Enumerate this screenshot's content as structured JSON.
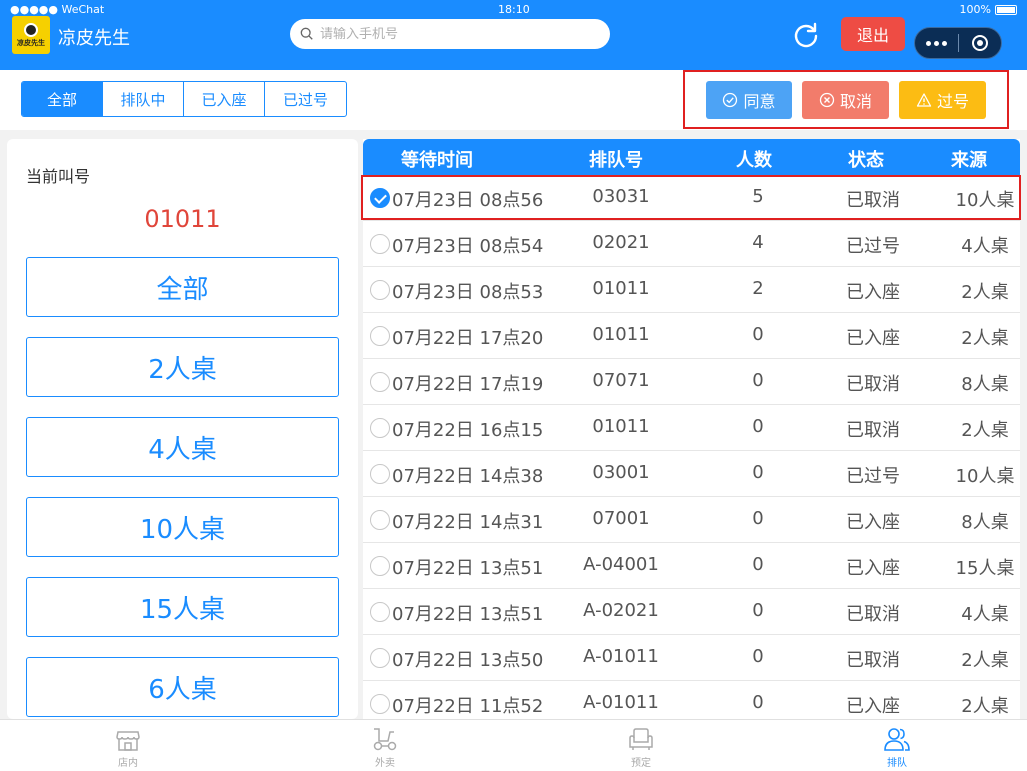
{
  "status_bar": {
    "carrier": "●●●●● WeChat",
    "time": "18:10",
    "battery": "100%"
  },
  "header": {
    "logo_text": "凉皮先生",
    "title": "凉皮先生",
    "search_placeholder": "请输入手机号",
    "logout": "退出"
  },
  "filters": {
    "tabs": [
      "全部",
      "排队中",
      "已入座",
      "已过号"
    ],
    "active": 0
  },
  "actions": {
    "agree": "同意",
    "cancel": "取消",
    "pass": "过号"
  },
  "left_panel": {
    "current_label": "当前叫号",
    "current_number": "01011",
    "categories": [
      "全部",
      "2人桌",
      "4人桌",
      "10人桌",
      "15人桌",
      "6人桌"
    ]
  },
  "table": {
    "headers": [
      "等待时间",
      "排队号",
      "人数",
      "状态",
      "来源"
    ],
    "rows": [
      {
        "time": "07月23日 08点56",
        "number": "03031",
        "people": "5",
        "status": "已取消",
        "source": "10人桌",
        "selected": true
      },
      {
        "time": "07月23日 08点54",
        "number": "02021",
        "people": "4",
        "status": "已过号",
        "source": "4人桌",
        "selected": false
      },
      {
        "time": "07月23日 08点53",
        "number": "01011",
        "people": "2",
        "status": "已入座",
        "source": "2人桌",
        "selected": false
      },
      {
        "time": "07月22日 17点20",
        "number": "01011",
        "people": "0",
        "status": "已入座",
        "source": "2人桌",
        "selected": false
      },
      {
        "time": "07月22日 17点19",
        "number": "07071",
        "people": "0",
        "status": "已取消",
        "source": "8人桌",
        "selected": false
      },
      {
        "time": "07月22日 16点15",
        "number": "01011",
        "people": "0",
        "status": "已取消",
        "source": "2人桌",
        "selected": false
      },
      {
        "time": "07月22日 14点38",
        "number": "03001",
        "people": "0",
        "status": "已过号",
        "source": "10人桌",
        "selected": false
      },
      {
        "time": "07月22日 14点31",
        "number": "07001",
        "people": "0",
        "status": "已入座",
        "source": "8人桌",
        "selected": false
      },
      {
        "time": "07月22日 13点51",
        "number": "A-04001",
        "people": "0",
        "status": "已入座",
        "source": "15人桌",
        "selected": false
      },
      {
        "time": "07月22日 13点51",
        "number": "A-02021",
        "people": "0",
        "status": "已取消",
        "source": "4人桌",
        "selected": false
      },
      {
        "time": "07月22日 13点50",
        "number": "A-01011",
        "people": "0",
        "status": "已取消",
        "source": "2人桌",
        "selected": false
      },
      {
        "time": "07月22日 11点52",
        "number": "A-01011",
        "people": "0",
        "status": "已入座",
        "source": "2人桌",
        "selected": false
      }
    ]
  },
  "tabbar": {
    "items": [
      {
        "label": "店内",
        "icon": "store-icon"
      },
      {
        "label": "外卖",
        "icon": "scooter-icon"
      },
      {
        "label": "预定",
        "icon": "sofa-icon"
      },
      {
        "label": "排队",
        "icon": "people-icon"
      }
    ],
    "active": 3
  },
  "colors": {
    "primary": "#1a8cff",
    "danger": "#ee4c44",
    "warning": "#fcbc13",
    "cancel": "#f27c6b",
    "agree": "#4da3f5"
  }
}
